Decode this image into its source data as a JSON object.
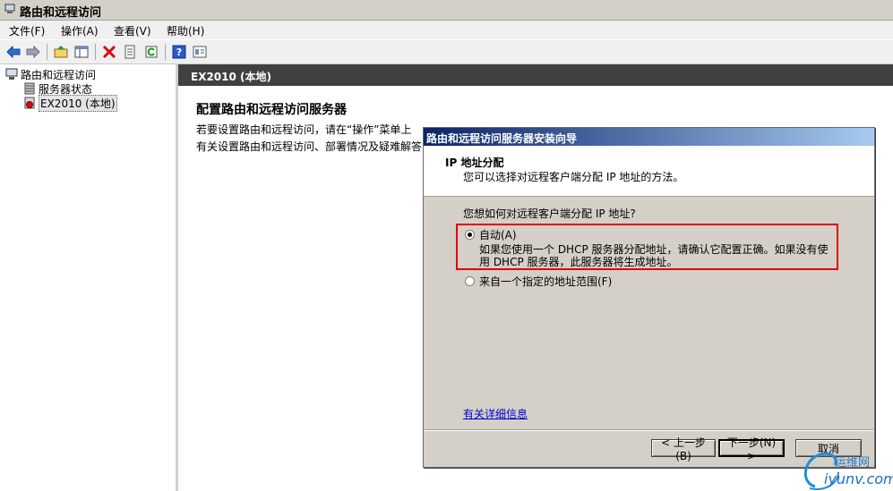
{
  "window": {
    "title": "路由和远程访问"
  },
  "menubar": {
    "items": [
      {
        "label": "文件(F)"
      },
      {
        "label": "操作(A)"
      },
      {
        "label": "查看(V)"
      },
      {
        "label": "帮助(H)"
      }
    ]
  },
  "toolbar": {
    "icons": [
      "back-arrow-icon",
      "forward-arrow-icon",
      "up-folder-icon",
      "show-hide-tree-icon",
      "delete-icon",
      "properties-icon",
      "refresh-icon",
      "help-icon",
      "console-icon"
    ]
  },
  "tree": {
    "root": "路由和远程访问",
    "items": [
      {
        "label": "服务器状态"
      },
      {
        "label": "EX2010 (本地)",
        "selected": true
      }
    ]
  },
  "content": {
    "header": "EX2010 (本地)",
    "title": "配置路由和远程访问服务器",
    "line1": "若要设置路由和远程访问，请在“操作”菜单上",
    "line2": "有关设置路由和远程访问、部署情况及疑难解答"
  },
  "wizard": {
    "title": "路由和远程访问服务器安装向导",
    "head_title": "IP 地址分配",
    "head_subtitle": "您可以选择对远程客户端分配 IP 地址的方法。",
    "question": "您想如何对远程客户端分配 IP 地址?",
    "option_auto": {
      "label": "自动(A)",
      "selected": true,
      "desc1": "如果您使用一个 DHCP 服务器分配地址，请确认它配置正确。如果没有使",
      "desc2": "用 DHCP 服务器，此服务器将生成地址。"
    },
    "option_range": {
      "label": "来自一个指定的地址范围(F)",
      "selected": false
    },
    "more_info": "有关详细信息",
    "buttons": {
      "back": "< 上一步(B)",
      "next": "下一步(N) >",
      "cancel": "取消"
    }
  },
  "watermark": {
    "cn": "运维网",
    "url": "iyunv.com"
  },
  "colors": {
    "highlight_box": "#e00000",
    "wizard_title": "#0a246a",
    "content_header": "#404040"
  }
}
